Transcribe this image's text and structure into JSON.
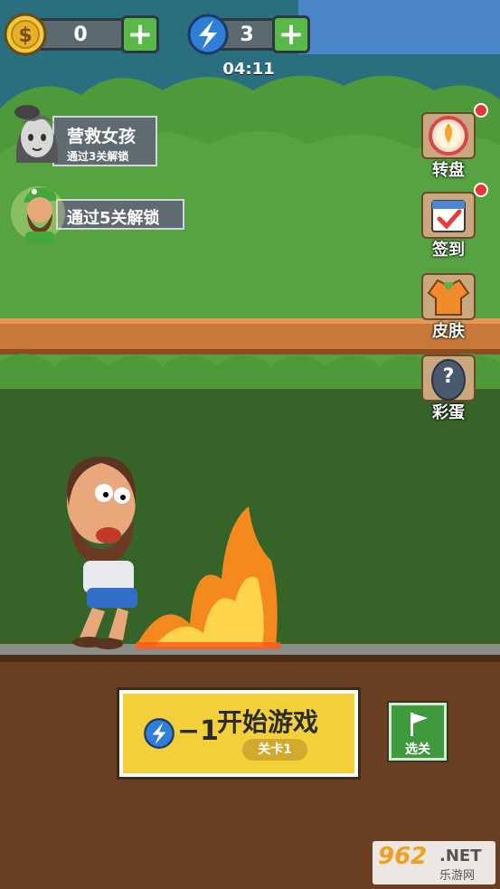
{
  "topbar": {
    "coins": "0",
    "energy": "3",
    "timer": "04:11",
    "plus_symbol": "+"
  },
  "unlocks": [
    {
      "title": "营救女孩",
      "subtitle": "通过3关解锁"
    },
    {
      "title": "通过5关解锁"
    }
  ],
  "side_menu": {
    "wheel": "转盘",
    "checkin": "签到",
    "skin": "皮肤",
    "easter_egg": "彩蛋",
    "easter_egg_glyph": "?"
  },
  "start": {
    "cost": "−1",
    "label": "开始游戏",
    "level": "关卡1"
  },
  "select_level": {
    "label": "选关"
  },
  "watermark": {
    "brand": "962",
    "net": ".NET",
    "sub": "乐游网"
  },
  "colors": {
    "sky": "#2a6f7f",
    "bush": "#4e9a3a",
    "wall": "#3b6a2b",
    "ground": "#6b3f22",
    "accent_yellow": "#f3cf3a",
    "accent_green": "#58b84a",
    "notify_red": "#e8343a"
  },
  "icons": {
    "coin": "coin-icon",
    "energy": "lightning-icon",
    "wheel": "prize-wheel-icon",
    "calendar": "calendar-check-icon",
    "shirt": "jacket-icon",
    "flag": "flag-icon"
  }
}
